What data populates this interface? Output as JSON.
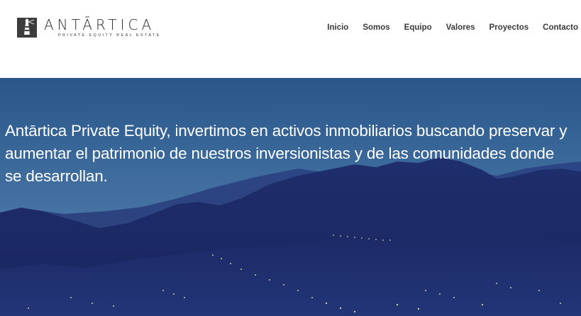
{
  "brand": {
    "name": "ANTĀRTICA",
    "tagline": "PRIVATE EQUITY REAL ESTATE",
    "logo_icon": "lighthouse-icon"
  },
  "nav": {
    "items": [
      {
        "label": "Inicio"
      },
      {
        "label": "Somos"
      },
      {
        "label": "Equipo"
      },
      {
        "label": "Valores"
      },
      {
        "label": "Proyectos"
      },
      {
        "label": "Contacto"
      }
    ]
  },
  "hero": {
    "text": "Antārtica Private Equity, invertimos en activos inmobiliarios buscando preservar y aumentar el patrimonio de nuestros inversionistas y de las comunidades donde se desarrollan."
  },
  "colors": {
    "header_bg": "#ffffff",
    "nav_text": "#3a3a3a",
    "hero_sky_top": "#2c5a8d",
    "hero_mountains": "#1e2f6e",
    "hero_text": "#ffffff"
  }
}
